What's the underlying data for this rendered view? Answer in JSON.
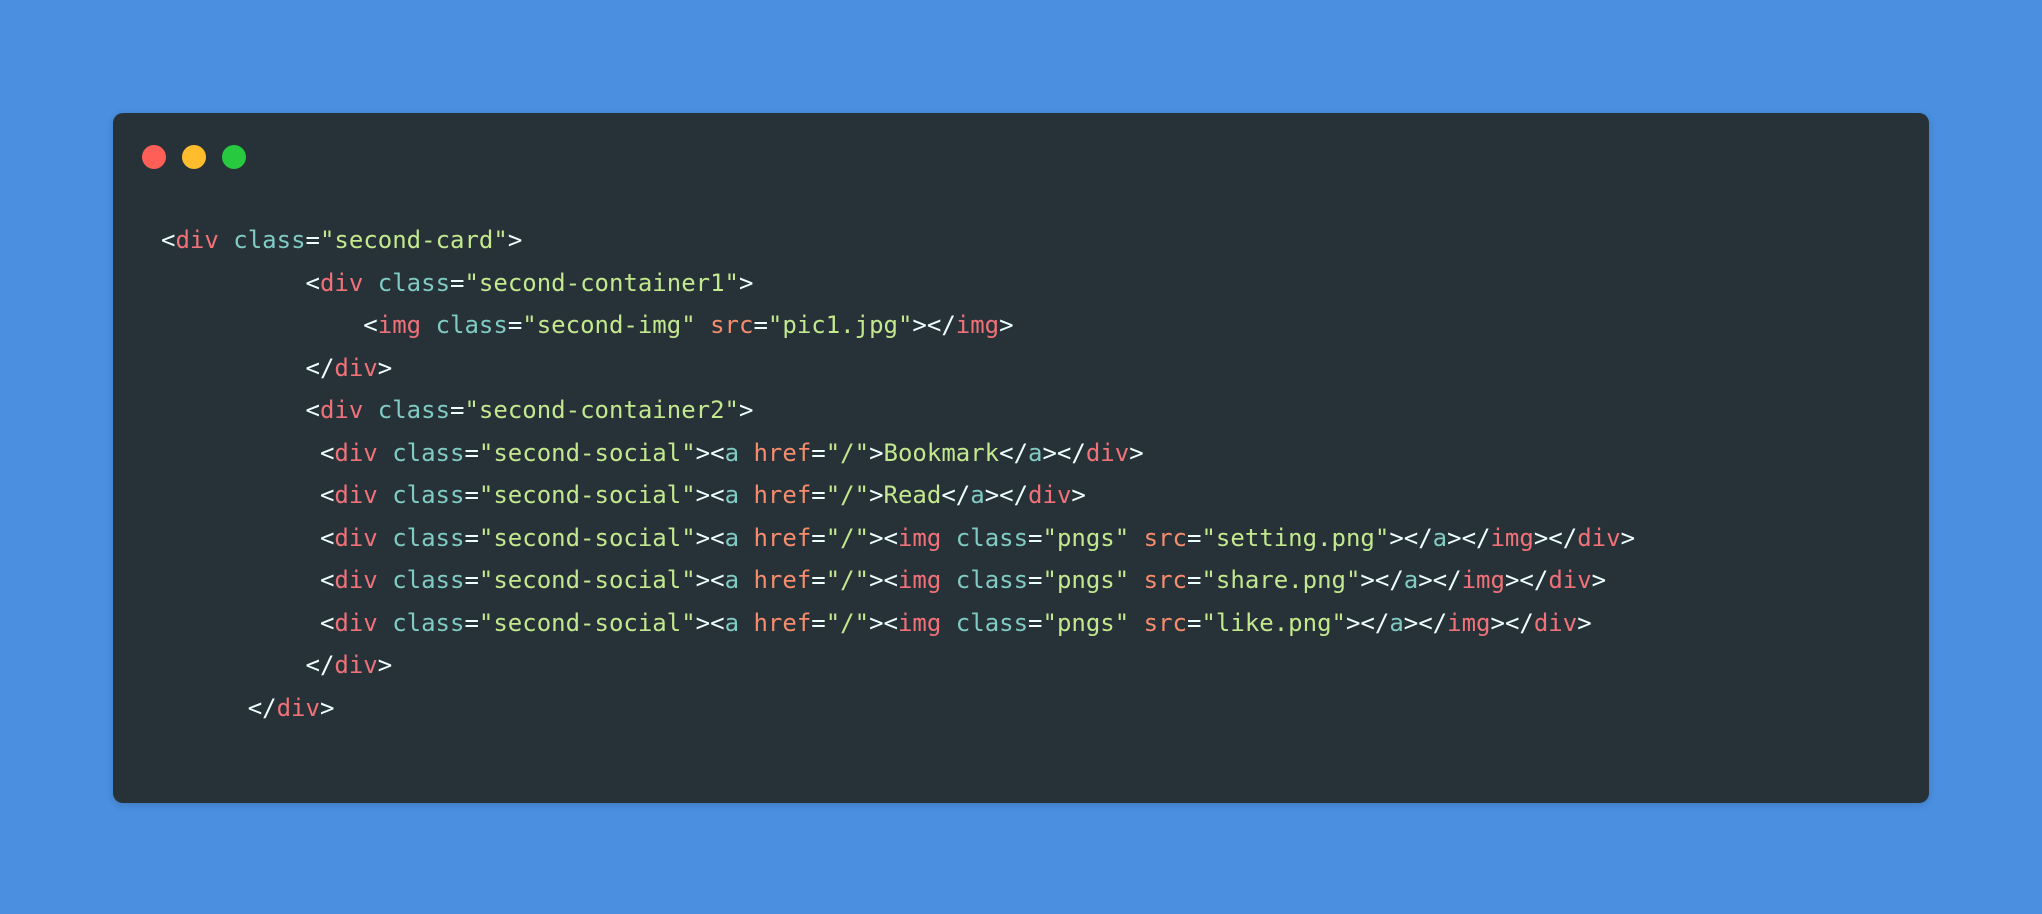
{
  "colors": {
    "background": "#4a8fe0",
    "window": "#263238",
    "dot_red": "#ff5f56",
    "dot_yellow": "#ffbd2e",
    "dot_green": "#27c93f",
    "punctuation": "#eeffff",
    "tag": "#f07178",
    "attribute": "#80cbc4",
    "string": "#c3e88d",
    "attribute_alt": "#f78c6c"
  },
  "window_dots": [
    "close-dot",
    "minimize-dot",
    "maximize-dot"
  ],
  "code_lines": [
    [
      {
        "c": "p",
        "t": "<"
      },
      {
        "c": "t",
        "t": "div"
      },
      {
        "c": "p",
        "t": " "
      },
      {
        "c": "a",
        "t": "class"
      },
      {
        "c": "p",
        "t": "="
      },
      {
        "c": "s",
        "t": "\"second-card\""
      },
      {
        "c": "p",
        "t": ">"
      }
    ],
    [
      {
        "c": "p",
        "t": "          <"
      },
      {
        "c": "t",
        "t": "div"
      },
      {
        "c": "p",
        "t": " "
      },
      {
        "c": "a",
        "t": "class"
      },
      {
        "c": "p",
        "t": "="
      },
      {
        "c": "s",
        "t": "\"second-container1\""
      },
      {
        "c": "p",
        "t": ">"
      }
    ],
    [
      {
        "c": "p",
        "t": "              <"
      },
      {
        "c": "t",
        "t": "img"
      },
      {
        "c": "p",
        "t": " "
      },
      {
        "c": "a",
        "t": "class"
      },
      {
        "c": "p",
        "t": "="
      },
      {
        "c": "s",
        "t": "\"second-img\""
      },
      {
        "c": "p",
        "t": " "
      },
      {
        "c": "r",
        "t": "src"
      },
      {
        "c": "p",
        "t": "="
      },
      {
        "c": "s",
        "t": "\"pic1.jpg\""
      },
      {
        "c": "p",
        "t": "></"
      },
      {
        "c": "t",
        "t": "img"
      },
      {
        "c": "p",
        "t": ">"
      }
    ],
    [
      {
        "c": "p",
        "t": "          </"
      },
      {
        "c": "t",
        "t": "div"
      },
      {
        "c": "p",
        "t": ">"
      }
    ],
    [
      {
        "c": "p",
        "t": "          <"
      },
      {
        "c": "t",
        "t": "div"
      },
      {
        "c": "p",
        "t": " "
      },
      {
        "c": "a",
        "t": "class"
      },
      {
        "c": "p",
        "t": "="
      },
      {
        "c": "s",
        "t": "\"second-container2\""
      },
      {
        "c": "p",
        "t": ">"
      }
    ],
    [
      {
        "c": "p",
        "t": "           <"
      },
      {
        "c": "t",
        "t": "div"
      },
      {
        "c": "p",
        "t": " "
      },
      {
        "c": "a",
        "t": "class"
      },
      {
        "c": "p",
        "t": "="
      },
      {
        "c": "s",
        "t": "\"second-social\""
      },
      {
        "c": "p",
        "t": "><"
      },
      {
        "c": "a",
        "t": "a"
      },
      {
        "c": "p",
        "t": " "
      },
      {
        "c": "r",
        "t": "href"
      },
      {
        "c": "p",
        "t": "="
      },
      {
        "c": "s",
        "t": "\"/\""
      },
      {
        "c": "p",
        "t": ">"
      },
      {
        "c": "x",
        "t": "Bookmark"
      },
      {
        "c": "p",
        "t": "</"
      },
      {
        "c": "a",
        "t": "a"
      },
      {
        "c": "p",
        "t": "></"
      },
      {
        "c": "t",
        "t": "div"
      },
      {
        "c": "p",
        "t": ">"
      }
    ],
    [
      {
        "c": "p",
        "t": "           <"
      },
      {
        "c": "t",
        "t": "div"
      },
      {
        "c": "p",
        "t": " "
      },
      {
        "c": "a",
        "t": "class"
      },
      {
        "c": "p",
        "t": "="
      },
      {
        "c": "s",
        "t": "\"second-social\""
      },
      {
        "c": "p",
        "t": "><"
      },
      {
        "c": "a",
        "t": "a"
      },
      {
        "c": "p",
        "t": " "
      },
      {
        "c": "r",
        "t": "href"
      },
      {
        "c": "p",
        "t": "="
      },
      {
        "c": "s",
        "t": "\"/\""
      },
      {
        "c": "p",
        "t": ">"
      },
      {
        "c": "x",
        "t": "Read"
      },
      {
        "c": "p",
        "t": "</"
      },
      {
        "c": "a",
        "t": "a"
      },
      {
        "c": "p",
        "t": "></"
      },
      {
        "c": "t",
        "t": "div"
      },
      {
        "c": "p",
        "t": ">"
      }
    ],
    [
      {
        "c": "p",
        "t": "           <"
      },
      {
        "c": "t",
        "t": "div"
      },
      {
        "c": "p",
        "t": " "
      },
      {
        "c": "a",
        "t": "class"
      },
      {
        "c": "p",
        "t": "="
      },
      {
        "c": "s",
        "t": "\"second-social\""
      },
      {
        "c": "p",
        "t": "><"
      },
      {
        "c": "a",
        "t": "a"
      },
      {
        "c": "p",
        "t": " "
      },
      {
        "c": "r",
        "t": "href"
      },
      {
        "c": "p",
        "t": "="
      },
      {
        "c": "s",
        "t": "\"/\""
      },
      {
        "c": "p",
        "t": "><"
      },
      {
        "c": "t",
        "t": "img"
      },
      {
        "c": "p",
        "t": " "
      },
      {
        "c": "a",
        "t": "class"
      },
      {
        "c": "p",
        "t": "="
      },
      {
        "c": "s",
        "t": "\"pngs\""
      },
      {
        "c": "p",
        "t": " "
      },
      {
        "c": "r",
        "t": "src"
      },
      {
        "c": "p",
        "t": "="
      },
      {
        "c": "s",
        "t": "\"setting.png\""
      },
      {
        "c": "p",
        "t": "></"
      },
      {
        "c": "a",
        "t": "a"
      },
      {
        "c": "p",
        "t": "></"
      },
      {
        "c": "t",
        "t": "img"
      },
      {
        "c": "p",
        "t": "></"
      },
      {
        "c": "t",
        "t": "div"
      },
      {
        "c": "p",
        "t": ">"
      }
    ],
    [
      {
        "c": "p",
        "t": "           <"
      },
      {
        "c": "t",
        "t": "div"
      },
      {
        "c": "p",
        "t": " "
      },
      {
        "c": "a",
        "t": "class"
      },
      {
        "c": "p",
        "t": "="
      },
      {
        "c": "s",
        "t": "\"second-social\""
      },
      {
        "c": "p",
        "t": "><"
      },
      {
        "c": "a",
        "t": "a"
      },
      {
        "c": "p",
        "t": " "
      },
      {
        "c": "r",
        "t": "href"
      },
      {
        "c": "p",
        "t": "="
      },
      {
        "c": "s",
        "t": "\"/\""
      },
      {
        "c": "p",
        "t": "><"
      },
      {
        "c": "t",
        "t": "img"
      },
      {
        "c": "p",
        "t": " "
      },
      {
        "c": "a",
        "t": "class"
      },
      {
        "c": "p",
        "t": "="
      },
      {
        "c": "s",
        "t": "\"pngs\""
      },
      {
        "c": "p",
        "t": " "
      },
      {
        "c": "r",
        "t": "src"
      },
      {
        "c": "p",
        "t": "="
      },
      {
        "c": "s",
        "t": "\"share.png\""
      },
      {
        "c": "p",
        "t": "></"
      },
      {
        "c": "a",
        "t": "a"
      },
      {
        "c": "p",
        "t": "></"
      },
      {
        "c": "t",
        "t": "img"
      },
      {
        "c": "p",
        "t": "></"
      },
      {
        "c": "t",
        "t": "div"
      },
      {
        "c": "p",
        "t": ">"
      }
    ],
    [
      {
        "c": "p",
        "t": "           <"
      },
      {
        "c": "t",
        "t": "div"
      },
      {
        "c": "p",
        "t": " "
      },
      {
        "c": "a",
        "t": "class"
      },
      {
        "c": "p",
        "t": "="
      },
      {
        "c": "s",
        "t": "\"second-social\""
      },
      {
        "c": "p",
        "t": "><"
      },
      {
        "c": "a",
        "t": "a"
      },
      {
        "c": "p",
        "t": " "
      },
      {
        "c": "r",
        "t": "href"
      },
      {
        "c": "p",
        "t": "="
      },
      {
        "c": "s",
        "t": "\"/\""
      },
      {
        "c": "p",
        "t": "><"
      },
      {
        "c": "t",
        "t": "img"
      },
      {
        "c": "p",
        "t": " "
      },
      {
        "c": "a",
        "t": "class"
      },
      {
        "c": "p",
        "t": "="
      },
      {
        "c": "s",
        "t": "\"pngs\""
      },
      {
        "c": "p",
        "t": " "
      },
      {
        "c": "r",
        "t": "src"
      },
      {
        "c": "p",
        "t": "="
      },
      {
        "c": "s",
        "t": "\"like.png\""
      },
      {
        "c": "p",
        "t": "></"
      },
      {
        "c": "a",
        "t": "a"
      },
      {
        "c": "p",
        "t": "></"
      },
      {
        "c": "t",
        "t": "img"
      },
      {
        "c": "p",
        "t": "></"
      },
      {
        "c": "t",
        "t": "div"
      },
      {
        "c": "p",
        "t": ">"
      }
    ],
    [
      {
        "c": "p",
        "t": "          </"
      },
      {
        "c": "t",
        "t": "div"
      },
      {
        "c": "p",
        "t": ">"
      }
    ],
    [
      {
        "c": "p",
        "t": "      </"
      },
      {
        "c": "t",
        "t": "div"
      },
      {
        "c": "p",
        "t": ">"
      }
    ]
  ]
}
